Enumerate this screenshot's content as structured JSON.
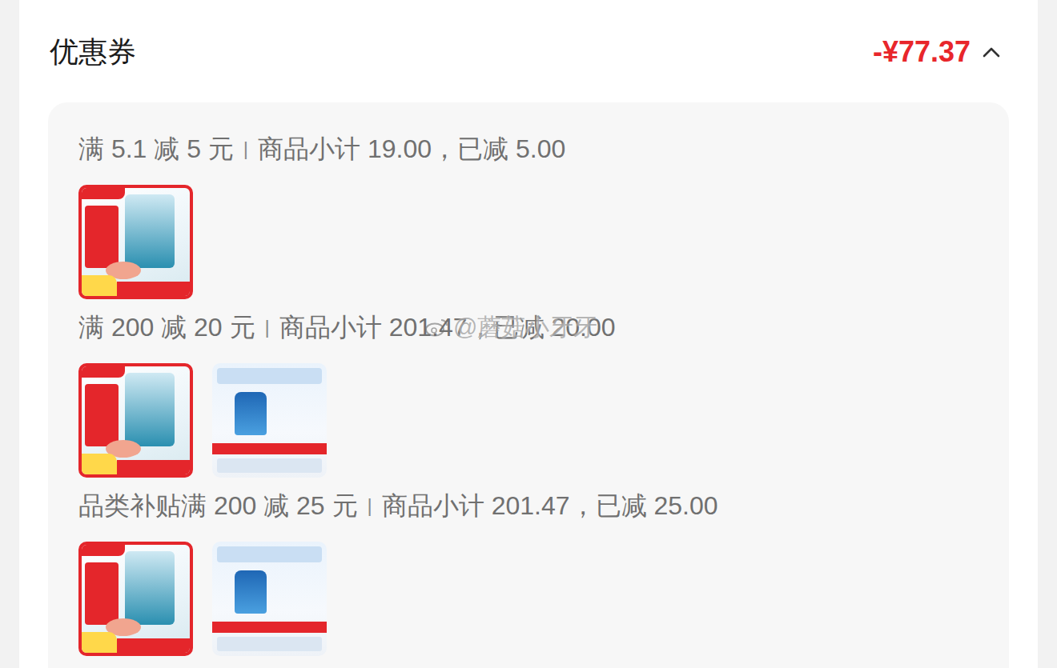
{
  "header": {
    "title": "优惠券",
    "total": "-¥77.37",
    "expanded": true
  },
  "separator": "|",
  "coupons": [
    {
      "label": "满 5.1 减 5 元",
      "detail": "商品小计 19.00，已减 5.00",
      "products": [
        {
          "kind": "cat-food"
        }
      ]
    },
    {
      "label": "满 200 减 20 元",
      "detail": "商品小计 201.47，已减 20.00",
      "products": [
        {
          "kind": "cat-food"
        },
        {
          "kind": "supplement"
        }
      ]
    },
    {
      "label": "品类补贴满 200 减 25 元",
      "detail": "商品小计 201.47，已减 25.00",
      "products": [
        {
          "kind": "cat-food"
        },
        {
          "kind": "supplement"
        }
      ]
    }
  ],
  "watermark": "@蘑菇小牙牙"
}
